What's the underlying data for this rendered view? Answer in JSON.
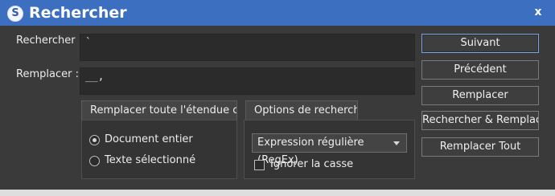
{
  "window": {
    "title": "Rechercher",
    "icon": "app-logo-icon",
    "close_glyph": "x"
  },
  "search": {
    "label": "Rechercher :",
    "value": "`"
  },
  "replace": {
    "label": "Remplacer :",
    "value": "__,"
  },
  "tabs": [
    {
      "label": "Remplacer toute l'étendue choisi"
    },
    {
      "label": "Options de recherche"
    }
  ],
  "scope": {
    "options": [
      {
        "label": "Document entier",
        "checked": true
      },
      {
        "label": "Texte sélectionné",
        "checked": false
      }
    ]
  },
  "options": {
    "mode": "Expression régulière (RegEx)",
    "ignore_case": {
      "label": "Ignorer la casse",
      "checked": false
    }
  },
  "buttons": {
    "next": "Suivant",
    "previous": "Précédent",
    "replace": "Remplacer",
    "find_replace": "Rechercher & Remplacer",
    "replace_all": "Remplacer Tout"
  },
  "colors": {
    "titlebar": "#3c6fc0",
    "background": "#3a3a3a",
    "accent_border": "#7aa5e6"
  }
}
